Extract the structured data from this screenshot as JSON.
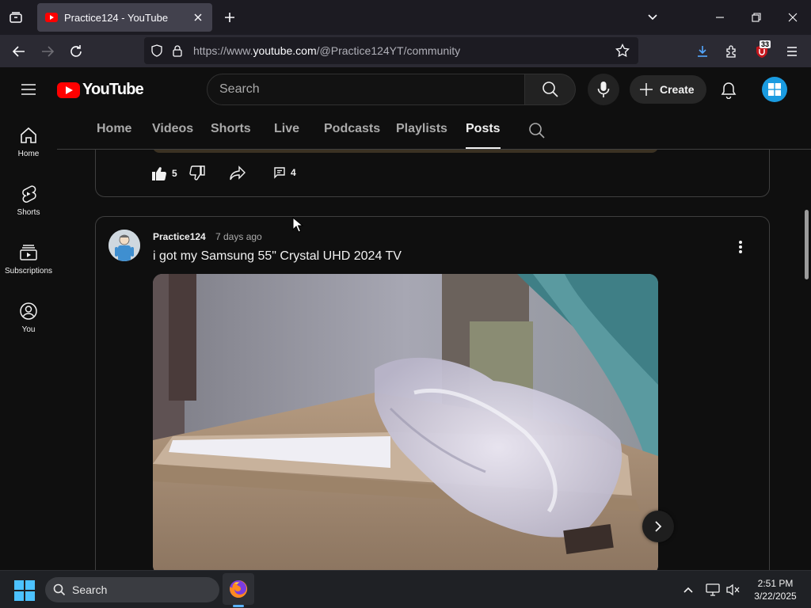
{
  "browser": {
    "tab_title": "Practice124 - YouTube",
    "url_prefix": "https://www.",
    "url_domain": "youtube.com",
    "url_path": "/@Practice124YT/community",
    "extension_badge": "33"
  },
  "youtube": {
    "logo_text": "YouTube",
    "search_placeholder": "Search",
    "create_label": "Create",
    "guide": [
      {
        "label": "Home"
      },
      {
        "label": "Shorts"
      },
      {
        "label": "Subscriptions"
      },
      {
        "label": "You"
      }
    ],
    "channel_tabs": [
      {
        "label": "Home"
      },
      {
        "label": "Videos"
      },
      {
        "label": "Shorts"
      },
      {
        "label": "Live"
      },
      {
        "label": "Podcasts"
      },
      {
        "label": "Playlists"
      },
      {
        "label": "Posts"
      }
    ],
    "active_tab": "Posts",
    "prev_post": {
      "likes": "5",
      "comments": "4"
    },
    "post": {
      "author": "Practice124",
      "time": "7 days ago",
      "text": "i got my Samsung 55\" Crystal UHD 2024 TV"
    }
  },
  "taskbar": {
    "search_label": "Search",
    "time": "2:51 PM",
    "date": "3/22/2025"
  },
  "colors": {
    "brand_red": "#ff0000",
    "background": "#0f0f0f",
    "avatar_blue": "#1a9be0"
  }
}
